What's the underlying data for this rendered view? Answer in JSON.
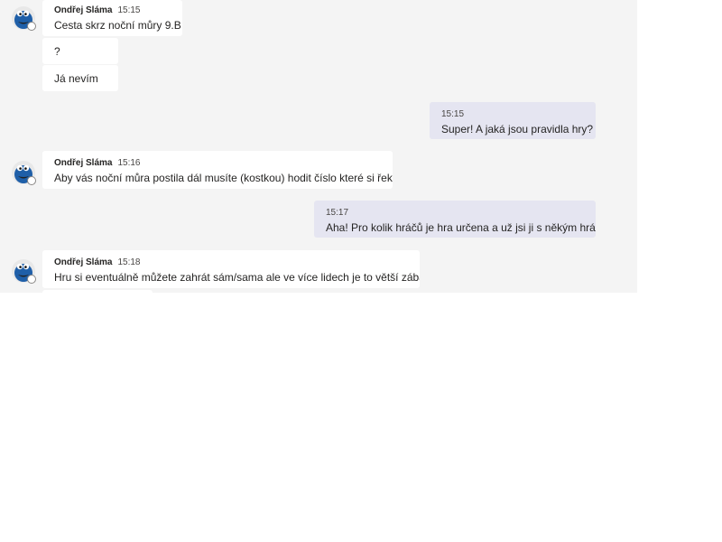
{
  "messages": [
    {
      "sender": "Ondřej Sláma",
      "time": "15:15",
      "text": "Cesta skrz noční můry 9.B"
    },
    {
      "text": "?"
    },
    {
      "text": "Já nevím"
    },
    {
      "time": "15:15",
      "text": "Super! A jaká jsou pravidla hry?"
    },
    {
      "sender": "Ondřej Sláma",
      "time": "15:16",
      "text": "Aby vás noční můra postila dál musíte (kostkou) hodit číslo které si řekne"
    },
    {
      "time": "15:17",
      "text": "Aha! Pro kolik hráčů je hra určena a už jsi ji s někým hrál?"
    },
    {
      "sender": "Ondřej Sláma",
      "time": "15:18",
      "text": "Hru si eventuálně můžete zahrát sám/sama ale ve více lidech je to větší zábava."
    }
  ],
  "colors": {
    "pane_background": "#f4f4f4",
    "incoming_bubble": "#ffffff",
    "outgoing_bubble": "#e5e5f1",
    "avatar_blue": "#1f5fa8"
  },
  "icons": {
    "avatar": "cookie-monster-avatar-icon",
    "status": "presence-status-icon"
  }
}
